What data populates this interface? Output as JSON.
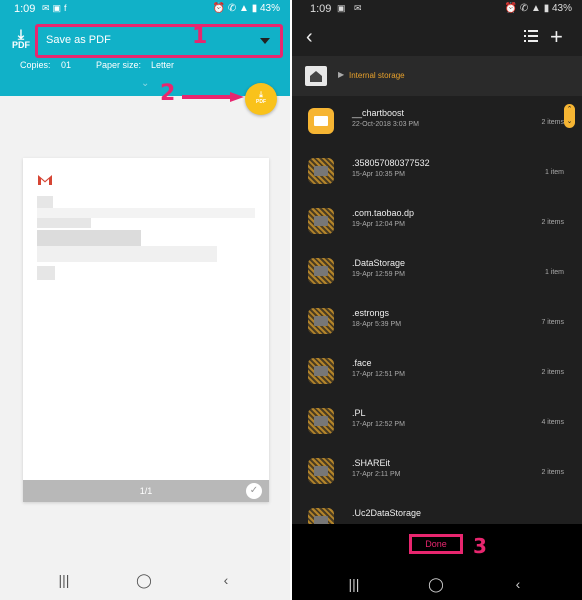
{
  "left": {
    "status": {
      "time": "1:09",
      "battery": "43%"
    },
    "print_dest_icon_label": "PDF",
    "destination": "Save as PDF",
    "copies_label": "Copies:",
    "copies_value": "01",
    "paper_label": "Paper size:",
    "paper_value": "Letter",
    "fab_label": "PDF",
    "callout_1": "1",
    "callout_2": "2",
    "page_indicator": "1/1"
  },
  "right": {
    "status": {
      "time": "1:09",
      "battery": "43%"
    },
    "breadcrumb": "Internal storage",
    "folders": [
      {
        "name": "__chartboost",
        "date": "22-Oct-2018 3:03 PM",
        "count": "2 items",
        "open": true
      },
      {
        "name": ".358057080377532",
        "date": "15-Apr 10:35 PM",
        "count": "1 item",
        "open": false
      },
      {
        "name": ".com.taobao.dp",
        "date": "19-Apr 12:04 PM",
        "count": "2 items",
        "open": false
      },
      {
        "name": ".DataStorage",
        "date": "19-Apr 12:59 PM",
        "count": "1 item",
        "open": false
      },
      {
        "name": ".estrongs",
        "date": "18-Apr 5:39 PM",
        "count": "7 items",
        "open": false
      },
      {
        "name": ".face",
        "date": "17-Apr 12:51 PM",
        "count": "2 items",
        "open": false
      },
      {
        "name": ".PL",
        "date": "17-Apr 12:52 PM",
        "count": "4 items",
        "open": false
      },
      {
        "name": ".SHAREit",
        "date": "17-Apr 2:11 PM",
        "count": "2 items",
        "open": false
      },
      {
        "name": ".Uc2DataStorage",
        "date": "",
        "count": "",
        "open": false
      }
    ],
    "done_label": "Done",
    "callout_3": "3"
  },
  "colors": {
    "accent_teal": "#11b1c8",
    "highlight_pink": "#e8266f",
    "fab_yellow": "#f9c21b",
    "folder_orange": "#f6b533"
  },
  "icons": [
    "download-pdf-icon",
    "dropdown-triangle-icon",
    "chevron-down-icon",
    "gmail-icon",
    "check-icon",
    "back-arrow-icon",
    "list-view-icon",
    "add-icon",
    "home-icon",
    "folder-icon",
    "recents-icon",
    "home-nav-icon",
    "back-nav-icon"
  ]
}
